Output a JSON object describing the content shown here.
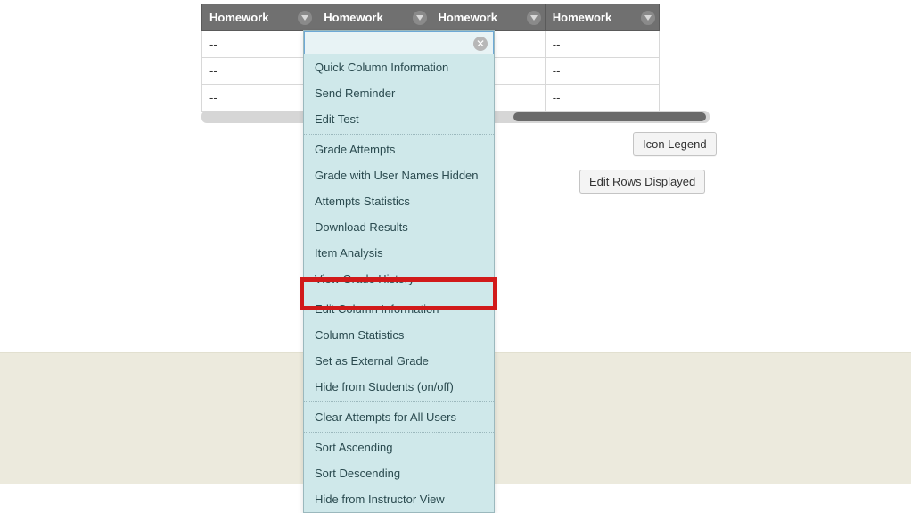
{
  "columns": [
    "Homework",
    "Homework",
    "Homework",
    "Homework"
  ],
  "rows": [
    [
      "--",
      "",
      "",
      "--"
    ],
    [
      "--",
      "",
      "",
      "--"
    ],
    [
      "--",
      "",
      "",
      "--"
    ]
  ],
  "buttons": {
    "icon_legend": "Icon Legend",
    "edit_rows": "Edit Rows Displayed"
  },
  "menu": {
    "group1": [
      "Quick Column Information",
      "Send Reminder",
      "Edit Test"
    ],
    "group2": [
      "Grade Attempts",
      "Grade with User Names Hidden",
      "Attempts Statistics",
      "Download Results",
      "Item Analysis",
      "View Grade History"
    ],
    "group3": [
      "Edit Column Information",
      "Column Statistics",
      "Set as External Grade",
      "Hide from Students (on/off)"
    ],
    "group4": [
      "Clear Attempts for All Users"
    ],
    "group5": [
      "Sort Ascending",
      "Sort Descending",
      "Hide from Instructor View"
    ],
    "highlighted_item": "Edit Column Information"
  }
}
